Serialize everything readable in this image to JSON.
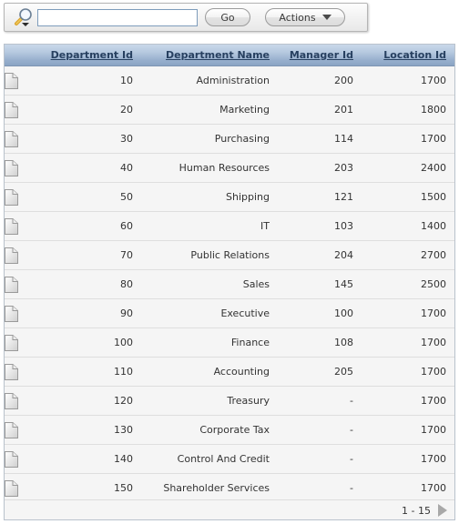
{
  "toolbar": {
    "search_icon": "search-magnifier-icon",
    "search_value": "",
    "search_placeholder": "",
    "go_label": "Go",
    "actions_label": "Actions",
    "actions_caret": "chevron-down-icon"
  },
  "table": {
    "columns": [
      {
        "key": "icon",
        "label": ""
      },
      {
        "key": "department_id",
        "label": "Department Id"
      },
      {
        "key": "department_name",
        "label": "Department Name"
      },
      {
        "key": "manager_id",
        "label": "Manager Id"
      },
      {
        "key": "location_id",
        "label": "Location Id"
      }
    ],
    "row_icon": "document-page-icon",
    "rows": [
      {
        "department_id": "10",
        "department_name": "Administration",
        "manager_id": "200",
        "location_id": "1700"
      },
      {
        "department_id": "20",
        "department_name": "Marketing",
        "manager_id": "201",
        "location_id": "1800"
      },
      {
        "department_id": "30",
        "department_name": "Purchasing",
        "manager_id": "114",
        "location_id": "1700"
      },
      {
        "department_id": "40",
        "department_name": "Human Resources",
        "manager_id": "203",
        "location_id": "2400"
      },
      {
        "department_id": "50",
        "department_name": "Shipping",
        "manager_id": "121",
        "location_id": "1500"
      },
      {
        "department_id": "60",
        "department_name": "IT",
        "manager_id": "103",
        "location_id": "1400"
      },
      {
        "department_id": "70",
        "department_name": "Public Relations",
        "manager_id": "204",
        "location_id": "2700"
      },
      {
        "department_id": "80",
        "department_name": "Sales",
        "manager_id": "145",
        "location_id": "2500"
      },
      {
        "department_id": "90",
        "department_name": "Executive",
        "manager_id": "100",
        "location_id": "1700"
      },
      {
        "department_id": "100",
        "department_name": "Finance",
        "manager_id": "108",
        "location_id": "1700"
      },
      {
        "department_id": "110",
        "department_name": "Accounting",
        "manager_id": "205",
        "location_id": "1700"
      },
      {
        "department_id": "120",
        "department_name": "Treasury",
        "manager_id": "-",
        "location_id": "1700"
      },
      {
        "department_id": "130",
        "department_name": "Corporate Tax",
        "manager_id": "-",
        "location_id": "1700"
      },
      {
        "department_id": "140",
        "department_name": "Control And Credit",
        "manager_id": "-",
        "location_id": "1700"
      },
      {
        "department_id": "150",
        "department_name": "Shareholder Services",
        "manager_id": "-",
        "location_id": "1700"
      }
    ]
  },
  "pagination": {
    "range_label": "1 - 15",
    "next_icon": "next-page-arrow-icon"
  },
  "colors": {
    "header_gradient_top": "#c9d8ea",
    "header_gradient_bottom": "#8aa4c4",
    "header_text": "#274060",
    "row_background": "#f5f5f5",
    "row_divider": "#dedede",
    "table_border": "#b9c2cc",
    "input_border": "#7e9cbb",
    "next_arrow": "#a8a8a8"
  }
}
